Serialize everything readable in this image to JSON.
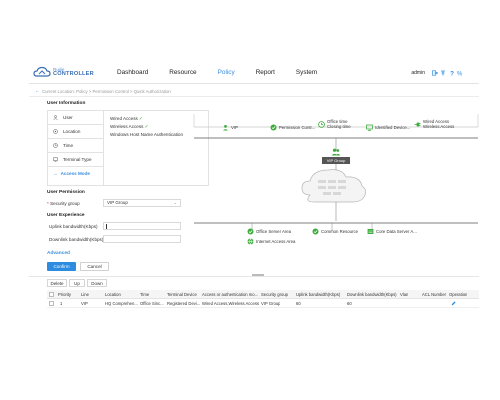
{
  "app": {
    "logo_line1": "Ruijie",
    "logo_line2": "CONTROLLER"
  },
  "nav": [
    "Dashboard",
    "Resource",
    "Policy",
    "Report",
    "System"
  ],
  "nav_active": "Policy",
  "header": {
    "user": "admin"
  },
  "breadcrumb": "Current Location: Policy > Permission Control > Quick Authorization",
  "user_info": {
    "title": "User Information",
    "tabs": [
      "User",
      "Location",
      "Time",
      "Terminal Type"
    ],
    "access_mode": "Access Mode",
    "items": [
      "Wired Access",
      "Wireless Access",
      "Windows Host Name Authentication"
    ]
  },
  "user_permission": {
    "title": "User Permission",
    "security_group_label": "Security group",
    "security_group_value": "VIP Group"
  },
  "user_experience": {
    "title": "User Experience",
    "uplink_label": "Uplink bandwidth(Kbps)",
    "downlink_label": "Downlink bandwidth(Kbps)"
  },
  "advanced": "Advanced",
  "buttons": {
    "confirm": "Confirm",
    "cancel": "Cancel"
  },
  "diagram": {
    "vip": "VIP",
    "permission": "Permission Contr...",
    "office_time": "Office time",
    "closing_time": "Closing time",
    "identified": "Identified Device...",
    "wired": "Wired Access",
    "wireless": "Wireless Access",
    "vip_group": "VIP Group",
    "resources": [
      "Office Server Area",
      "Common Resource",
      "Core Data Server A...",
      "Internet Access Area"
    ]
  },
  "toolbar": [
    "Delete",
    "Up",
    "Down"
  ],
  "table": {
    "headers": [
      "Priority",
      "Line",
      "Location",
      "Time",
      "Terminal Device",
      "Access or authentication mo...",
      "Security group",
      "Uplink bandwidth(Kbps)",
      "Downlink bandwidth(Kbps)",
      "Vlan",
      "ACL Number",
      "Operation"
    ],
    "rows": [
      [
        "1",
        "VIP",
        "HQ Comprehen...",
        "Office Sinc...",
        "Registered Devi...",
        "Wired Access,Wireless Access",
        "VIP Group",
        "60",
        "60",
        "",
        "",
        ""
      ]
    ]
  },
  "colors": {
    "accent": "#2d8ce0",
    "green": "#3bab3b"
  }
}
